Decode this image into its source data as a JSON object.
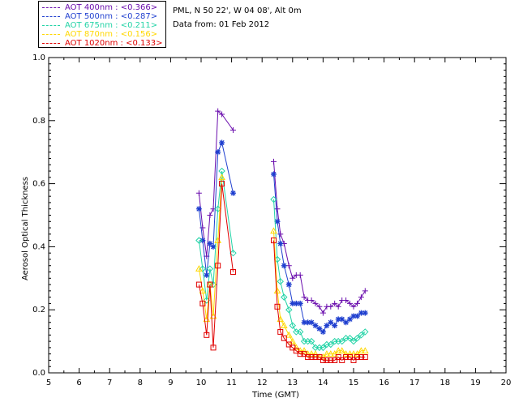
{
  "info": {
    "site": "PML, N 50 22', W 04 08', Alt 0m",
    "date": "Data from: 01 Feb 2012"
  },
  "chart_data": {
    "type": "scatter",
    "xlabel": "Time (GMT)",
    "ylabel": "Aerosol Optical Thickness",
    "xlim": [
      5,
      20
    ],
    "ylim": [
      0.0,
      1.0
    ],
    "x_ticks": [
      "5",
      "6",
      "7",
      "8",
      "9",
      "10",
      "11",
      "12",
      "13",
      "14",
      "15",
      "16",
      "17",
      "18",
      "19",
      "20"
    ],
    "y_ticks": [
      "0.0",
      "0.2",
      "0.4",
      "0.6",
      "0.8",
      "1.0"
    ],
    "grid": false,
    "legend_position": "top-left",
    "series": [
      {
        "name": "AOT 400nm : <0.366>",
        "color": "#6a0dad",
        "marker": "plus",
        "points": [
          [
            9.93,
            0.57
          ],
          [
            10.05,
            0.46
          ],
          [
            10.18,
            0.37
          ],
          [
            10.29,
            0.5
          ],
          [
            10.4,
            0.52
          ],
          [
            10.55,
            0.83
          ],
          [
            10.68,
            0.82
          ],
          [
            11.05,
            0.77
          ],
          [
            12.38,
            0.67
          ],
          [
            12.5,
            0.52
          ],
          [
            12.6,
            0.44
          ],
          [
            12.72,
            0.41
          ],
          [
            12.88,
            0.34
          ],
          [
            13.0,
            0.3
          ],
          [
            13.12,
            0.31
          ],
          [
            13.25,
            0.31
          ],
          [
            13.38,
            0.24
          ],
          [
            13.5,
            0.23
          ],
          [
            13.62,
            0.23
          ],
          [
            13.75,
            0.22
          ],
          [
            13.88,
            0.21
          ],
          [
            14.0,
            0.19
          ],
          [
            14.12,
            0.21
          ],
          [
            14.25,
            0.21
          ],
          [
            14.38,
            0.22
          ],
          [
            14.5,
            0.21
          ],
          [
            14.62,
            0.23
          ],
          [
            14.75,
            0.23
          ],
          [
            14.88,
            0.22
          ],
          [
            15.0,
            0.21
          ],
          [
            15.12,
            0.22
          ],
          [
            15.25,
            0.24
          ],
          [
            15.38,
            0.26
          ]
        ]
      },
      {
        "name": "AOT 500nm : <0.287>",
        "color": "#1f3fcf",
        "marker": "asterisk",
        "points": [
          [
            9.93,
            0.52
          ],
          [
            10.05,
            0.42
          ],
          [
            10.18,
            0.31
          ],
          [
            10.29,
            0.41
          ],
          [
            10.4,
            0.4
          ],
          [
            10.55,
            0.7
          ],
          [
            10.68,
            0.73
          ],
          [
            11.05,
            0.57
          ],
          [
            12.38,
            0.63
          ],
          [
            12.5,
            0.48
          ],
          [
            12.6,
            0.41
          ],
          [
            12.72,
            0.34
          ],
          [
            12.88,
            0.28
          ],
          [
            13.0,
            0.22
          ],
          [
            13.12,
            0.22
          ],
          [
            13.25,
            0.22
          ],
          [
            13.38,
            0.16
          ],
          [
            13.5,
            0.16
          ],
          [
            13.62,
            0.16
          ],
          [
            13.75,
            0.15
          ],
          [
            13.88,
            0.14
          ],
          [
            14.0,
            0.13
          ],
          [
            14.12,
            0.15
          ],
          [
            14.25,
            0.16
          ],
          [
            14.38,
            0.15
          ],
          [
            14.5,
            0.17
          ],
          [
            14.62,
            0.17
          ],
          [
            14.75,
            0.16
          ],
          [
            14.88,
            0.17
          ],
          [
            15.0,
            0.18
          ],
          [
            15.12,
            0.18
          ],
          [
            15.25,
            0.19
          ],
          [
            15.38,
            0.19
          ]
        ]
      },
      {
        "name": "AOT 675nm : <0.211>",
        "color": "#22d3a6",
        "marker": "diamond",
        "points": [
          [
            9.93,
            0.42
          ],
          [
            10.05,
            0.33
          ],
          [
            10.18,
            0.23
          ],
          [
            10.29,
            0.33
          ],
          [
            10.4,
            0.28
          ],
          [
            10.55,
            0.52
          ],
          [
            10.68,
            0.64
          ],
          [
            11.05,
            0.38
          ],
          [
            12.38,
            0.55
          ],
          [
            12.5,
            0.36
          ],
          [
            12.6,
            0.29
          ],
          [
            12.72,
            0.24
          ],
          [
            12.88,
            0.2
          ],
          [
            13.0,
            0.15
          ],
          [
            13.12,
            0.13
          ],
          [
            13.25,
            0.13
          ],
          [
            13.38,
            0.1
          ],
          [
            13.5,
            0.1
          ],
          [
            13.62,
            0.1
          ],
          [
            13.75,
            0.08
          ],
          [
            13.88,
            0.08
          ],
          [
            14.0,
            0.08
          ],
          [
            14.12,
            0.09
          ],
          [
            14.25,
            0.09
          ],
          [
            14.38,
            0.1
          ],
          [
            14.5,
            0.1
          ],
          [
            14.62,
            0.1
          ],
          [
            14.75,
            0.11
          ],
          [
            14.88,
            0.11
          ],
          [
            15.0,
            0.1
          ],
          [
            15.12,
            0.11
          ],
          [
            15.25,
            0.12
          ],
          [
            15.38,
            0.13
          ]
        ]
      },
      {
        "name": "AOT 870nm : <0.156>",
        "color": "#ffd700",
        "marker": "triangle",
        "points": [
          [
            9.93,
            0.33
          ],
          [
            10.05,
            0.26
          ],
          [
            10.18,
            0.17
          ],
          [
            10.29,
            0.28
          ],
          [
            10.4,
            0.18
          ],
          [
            10.55,
            0.42
          ],
          [
            10.68,
            0.62
          ],
          [
            12.38,
            0.45
          ],
          [
            12.5,
            0.26
          ],
          [
            12.6,
            0.17
          ],
          [
            12.72,
            0.15
          ],
          [
            12.88,
            0.12
          ],
          [
            13.0,
            0.1
          ],
          [
            13.12,
            0.08
          ],
          [
            13.25,
            0.07
          ],
          [
            13.38,
            0.07
          ],
          [
            13.5,
            0.06
          ],
          [
            13.62,
            0.06
          ],
          [
            13.75,
            0.06
          ],
          [
            13.88,
            0.05
          ],
          [
            14.0,
            0.05
          ],
          [
            14.12,
            0.06
          ],
          [
            14.25,
            0.06
          ],
          [
            14.38,
            0.06
          ],
          [
            14.5,
            0.07
          ],
          [
            14.62,
            0.07
          ],
          [
            14.75,
            0.06
          ],
          [
            14.88,
            0.06
          ],
          [
            15.0,
            0.06
          ],
          [
            15.12,
            0.06
          ],
          [
            15.25,
            0.07
          ],
          [
            15.38,
            0.07
          ]
        ]
      },
      {
        "name": "AOT 1020nm : <0.133>",
        "color": "#e00000",
        "marker": "square",
        "points": [
          [
            9.93,
            0.28
          ],
          [
            10.05,
            0.22
          ],
          [
            10.18,
            0.12
          ],
          [
            10.29,
            0.28
          ],
          [
            10.4,
            0.08
          ],
          [
            10.55,
            0.34
          ],
          [
            10.68,
            0.6
          ],
          [
            11.05,
            0.32
          ],
          [
            12.38,
            0.42
          ],
          [
            12.5,
            0.21
          ],
          [
            12.6,
            0.13
          ],
          [
            12.72,
            0.11
          ],
          [
            12.88,
            0.09
          ],
          [
            13.0,
            0.08
          ],
          [
            13.12,
            0.07
          ],
          [
            13.25,
            0.06
          ],
          [
            13.38,
            0.06
          ],
          [
            13.5,
            0.05
          ],
          [
            13.62,
            0.05
          ],
          [
            13.75,
            0.05
          ],
          [
            13.88,
            0.05
          ],
          [
            14.0,
            0.04
          ],
          [
            14.12,
            0.04
          ],
          [
            14.25,
            0.04
          ],
          [
            14.38,
            0.04
          ],
          [
            14.5,
            0.05
          ],
          [
            14.62,
            0.04
          ],
          [
            14.75,
            0.05
          ],
          [
            14.88,
            0.05
          ],
          [
            15.0,
            0.04
          ],
          [
            15.12,
            0.05
          ],
          [
            15.25,
            0.05
          ],
          [
            15.38,
            0.05
          ]
        ]
      }
    ]
  }
}
